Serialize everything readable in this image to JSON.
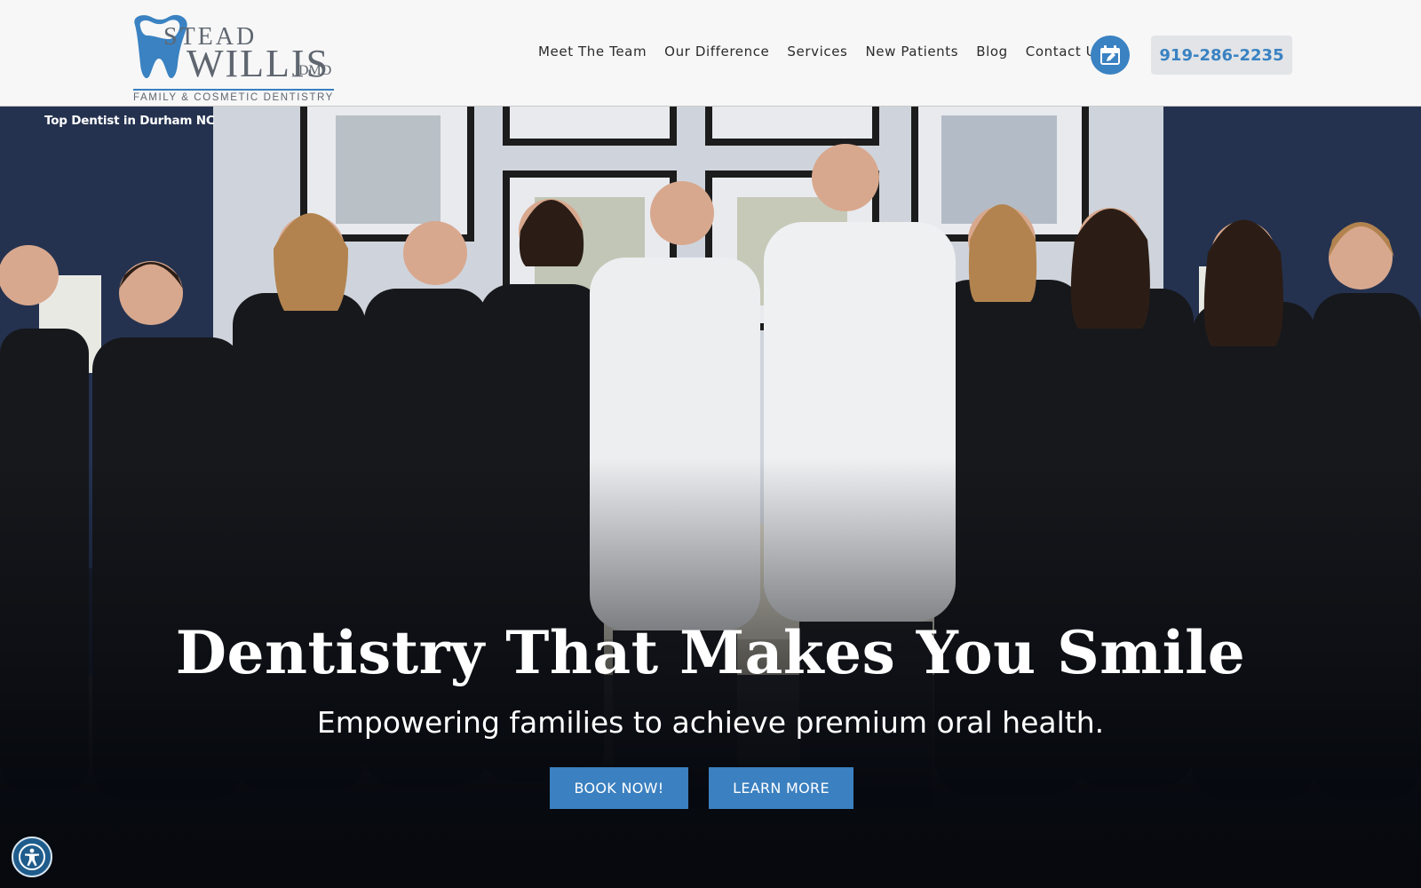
{
  "header": {
    "logo": {
      "line1": "STEAD",
      "line2": "WILLIS",
      "suffix": ", DMD",
      "tagline": "FAMILY & COSMETIC DENTISTRY"
    },
    "nav": [
      "Meet The Team",
      "Our Difference",
      "Services",
      "New Patients",
      "Blog",
      "Contact Us"
    ],
    "calendar_icon": "calendar-edit-icon",
    "phone": "919-286-2235"
  },
  "hero": {
    "top_label": "Top Dentist in Durham NC",
    "title": "Dentistry That Makes You Smile",
    "subtitle": "Empowering families to achieve premium oral health.",
    "buttons": {
      "book": "BOOK NOW!",
      "learn": "LEARN MORE"
    }
  },
  "accessibility_icon": "accessibility-person-icon",
  "colors": {
    "accent": "#3b80c0",
    "header_bg": "#f7f7f7",
    "logo_text": "#5f6670",
    "wall_navy": "#24324f"
  }
}
